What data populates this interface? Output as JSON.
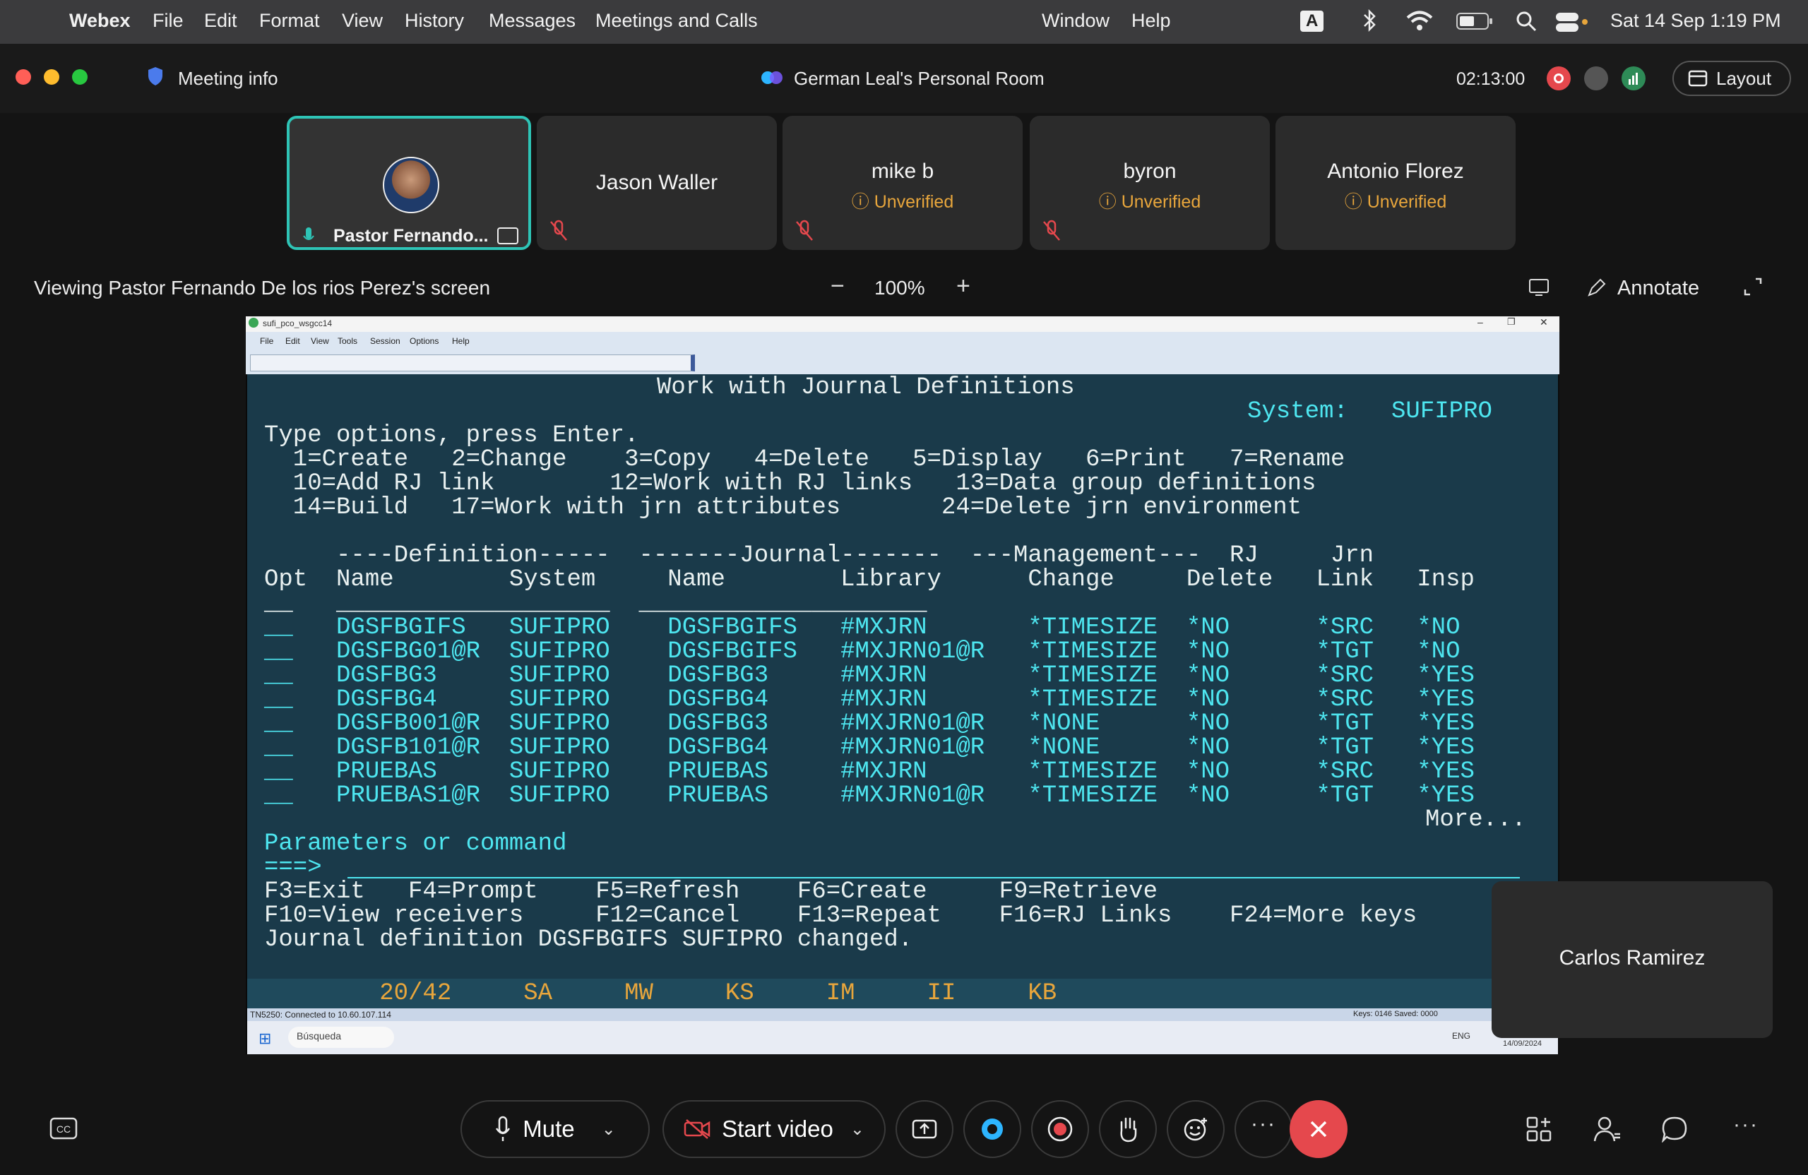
{
  "menubar": {
    "app": "Webex",
    "items": [
      "File",
      "Edit",
      "Format",
      "View",
      "History",
      "Messages",
      "Meetings and Calls"
    ],
    "right_items": [
      "Window",
      "Help"
    ],
    "input_indicator": "A",
    "datetime": "Sat 14 Sep  1:19 PM"
  },
  "titlebar": {
    "meeting_info": "Meeting info",
    "room_title": "German Leal's Personal Room",
    "timer": "02:13:00",
    "layout_label": "Layout"
  },
  "participants": [
    {
      "name": "Pastor Fernando...",
      "status": ""
    },
    {
      "name": "Jason Waller",
      "status": ""
    },
    {
      "name": "mike b",
      "status": "Unverified"
    },
    {
      "name": "byron",
      "status": "Unverified"
    },
    {
      "name": "Antonio Florez",
      "status": "Unverified"
    }
  ],
  "share_bar": {
    "viewing": "Viewing Pastor Fernando De los rios Perez's screen",
    "zoom": "100%",
    "annotate": "Annotate"
  },
  "remote": {
    "window_title": "sufi_pco_wsgcc14",
    "menu": [
      "File",
      "Edit",
      "View",
      "Tools",
      "Session",
      "Options",
      "Help"
    ],
    "status_left": "TN5250: Connected to 10.60.107.114",
    "status_right": "Keys: 0146  Saved: 0000",
    "search": "Búsqueda",
    "lang": "ENG",
    "date": "14/09/2024"
  },
  "terminal": {
    "title": "Work with Journal Definitions",
    "system": "System:   SUFIPRO",
    "instructions": "Type options, press Enter.",
    "opts1": "  1=Create   2=Change    3=Copy   4=Delete   5=Display   6=Print   7=Rename",
    "opts2": "  10=Add RJ link        12=Work with RJ links   13=Data group definitions",
    "opts3": "  14=Build   17=Work with jrn attributes       24=Delete jrn environment",
    "hdr1": "     ----Definition-----  -------Journal-------  ---Management---  RJ     Jrn",
    "hdr2": "Opt  Name        System     Name        Library      Change     Delete   Link   Insp",
    "rows": [
      "__   DGSFBGIFS   SUFIPRO    DGSFBGIFS   #MXJRN       *TIMESIZE  *NO      *SRC   *NO",
      "__   DGSFBG01@R  SUFIPRO    DGSFBGIFS   #MXJRN01@R   *TIMESIZE  *NO      *TGT   *NO",
      "__   DGSFBG3     SUFIPRO    DGSFBG3     #MXJRN       *TIMESIZE  *NO      *SRC   *YES",
      "__   DGSFBG4     SUFIPRO    DGSFBG4     #MXJRN       *TIMESIZE  *NO      *SRC   *YES",
      "__   DGSFB001@R  SUFIPRO    DGSFBG3     #MXJRN01@R   *NONE      *NO      *TGT   *YES",
      "__   DGSFB101@R  SUFIPRO    DGSFBG4     #MXJRN01@R   *NONE      *NO      *TGT   *YES",
      "__   PRUEBAS     SUFIPRO    PRUEBAS     #MXJRN       *TIMESIZE  *NO      *SRC   *YES",
      "__   PRUEBAS1@R  SUFIPRO    PRUEBAS     #MXJRN01@R   *TIMESIZE  *NO      *TGT   *YES"
    ],
    "more": "More...",
    "params": "Parameters or command",
    "prompt": "===>",
    "fkeys1": "F3=Exit   F4=Prompt    F5=Refresh    F6=Create     F9=Retrieve",
    "fkeys2": "F10=View receivers     F12=Cancel    F13=Repeat    F16=RJ Links    F24=More keys",
    "message": "Journal definition DGSFBGIFS SUFIPRO changed.",
    "status": "        20/42     SA     MW     KS     IM     II     KB"
  },
  "floating_participant": "Carlos Ramirez",
  "controls": {
    "mute": "Mute",
    "start_video": "Start video"
  }
}
